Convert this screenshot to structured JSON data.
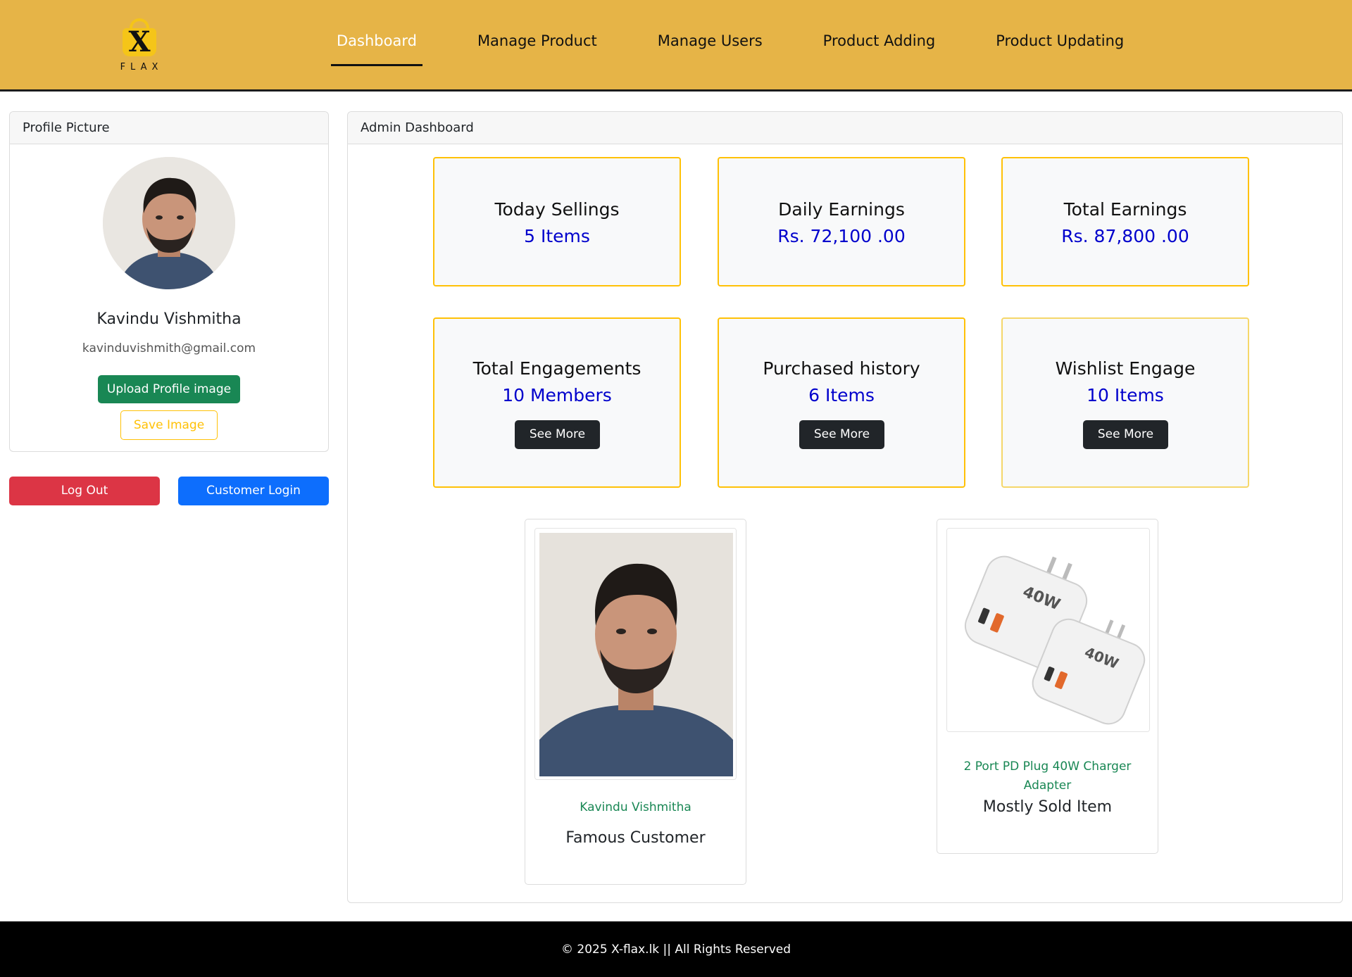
{
  "brand": {
    "logo_text": "FLAX",
    "logo_mark": "X"
  },
  "nav": {
    "items": [
      {
        "label": "Dashboard",
        "active": true
      },
      {
        "label": "Manage Product",
        "active": false
      },
      {
        "label": "Manage Users",
        "active": false
      },
      {
        "label": "Product Adding",
        "active": false
      },
      {
        "label": "Product Updating",
        "active": false
      }
    ]
  },
  "profile": {
    "header": "Profile Picture",
    "name": "Kavindu Vishmitha",
    "email": "kavinduvishmith@gmail.com",
    "upload_label": "Upload Profile image",
    "save_label": "Save Image"
  },
  "actions": {
    "logout_label": "Log Out",
    "customer_login_label": "Customer Login"
  },
  "dashboard": {
    "header": "Admin Dashboard",
    "stats": [
      {
        "title": "Today Sellings",
        "value": "5 Items"
      },
      {
        "title": "Daily Earnings",
        "value": "Rs. 72,100 .00"
      },
      {
        "title": "Total Earnings",
        "value": "Rs. 87,800 .00"
      },
      {
        "title": "Total Engagements",
        "value": "10 Members",
        "button": "See More"
      },
      {
        "title": "Purchased history",
        "value": "6 Items",
        "button": "See More"
      },
      {
        "title": "Wishlist Engage",
        "value": "10 Items",
        "button": "See More"
      }
    ],
    "famous_customer": {
      "name": "Kavindu Vishmitha",
      "caption": "Famous Customer"
    },
    "most_sold": {
      "name": "2 Port PD Plug 40W Charger Adapter",
      "caption": "Mostly Sold Item",
      "product_marking": "40W"
    }
  },
  "footer": {
    "text": "© 2025 X-flax.lk || All Rights Reserved"
  },
  "colors": {
    "header_bg": "#e6b447",
    "stat_border": "#ffc107",
    "stat_value": "#0000cc",
    "upload_btn": "#198754",
    "logout_btn": "#dc3545",
    "customer_btn": "#0d6efd",
    "see_more_btn": "#212529",
    "footer_bg": "#000000"
  }
}
